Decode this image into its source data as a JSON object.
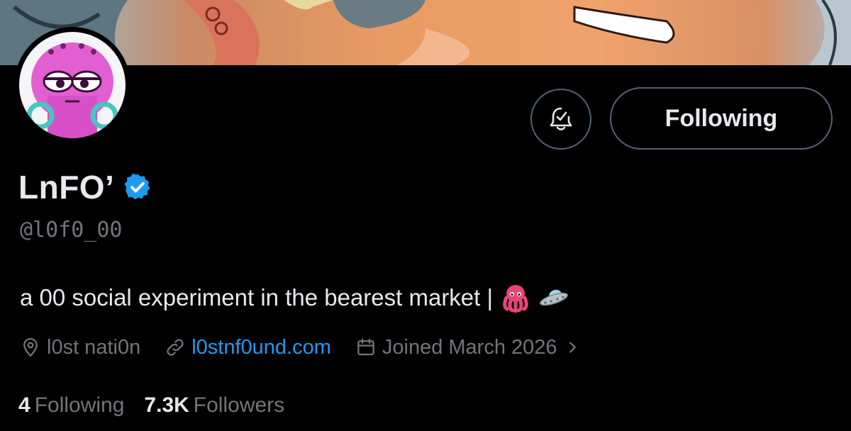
{
  "profile": {
    "display_name": "LnFO’",
    "handle": "@l0f0_00",
    "bio": "a 00 social experiment in the bearest market |",
    "bio_emojis": [
      "octopus-emoji",
      "ufo-emoji"
    ],
    "verified": true
  },
  "actions": {
    "notify_icon": "bell-check-icon",
    "follow_label": "Following"
  },
  "meta": {
    "location": "l0st nati0n",
    "website": "l0stnf0und.com",
    "joined": "Joined March 2026"
  },
  "stats": {
    "following_count": "4",
    "following_label": "Following",
    "followers_count": "7.3K",
    "followers_label": "Followers"
  },
  "colors": {
    "background": "#000000",
    "text_primary": "#e7e9ea",
    "text_secondary": "#71767b",
    "link": "#1d9bf0",
    "verified_badge": "#1d9bf0",
    "border": "#536471"
  }
}
